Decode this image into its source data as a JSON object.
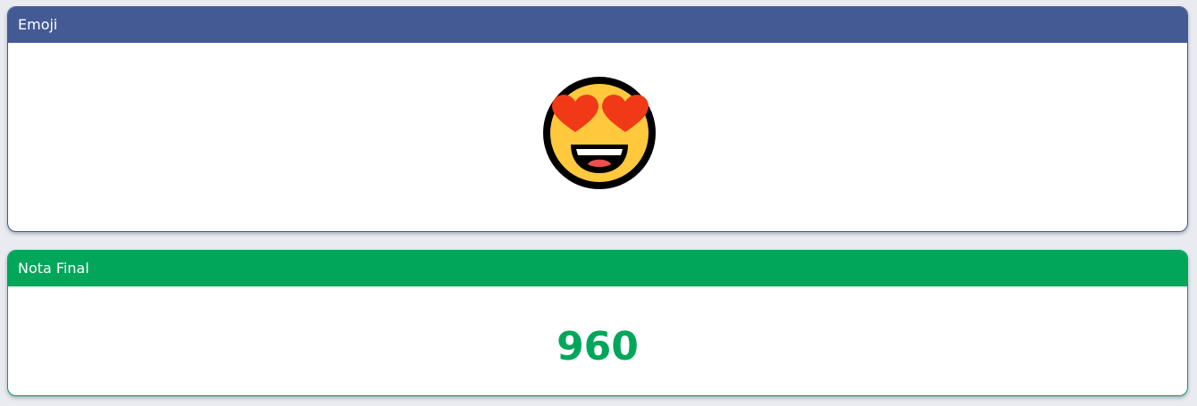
{
  "emoji_card": {
    "title": "Emoji",
    "emoji_icon": "smiling-face-with-heart-eyes-icon",
    "header_color": "#435a94"
  },
  "grade_card": {
    "title": "Nota Final",
    "value": "960",
    "header_color": "#00a65a",
    "value_color": "#00a65a"
  }
}
